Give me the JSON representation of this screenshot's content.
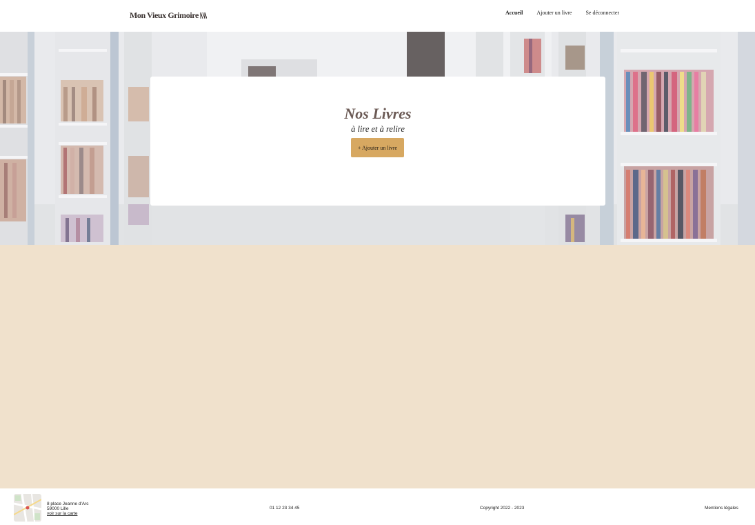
{
  "header": {
    "logo_text": "Mon Vieux Grimoire",
    "nav": [
      {
        "label": "Accueil",
        "active": true
      },
      {
        "label": "Ajouter un livre",
        "active": false
      },
      {
        "label": "Se déconnecter",
        "active": false
      }
    ]
  },
  "hero": {
    "title": "Nos Livres",
    "subtitle": "à lire et à relire",
    "button_label": "+ Ajouter un livre"
  },
  "footer": {
    "address_line1": "8 place Jeanne d'Arc",
    "address_line2": "59000 Lille",
    "map_link": "voir sur la carte",
    "phone": "01 12 23 34 45",
    "copyright": "Copyright 2022 - 2023",
    "legal": "Mentions légales"
  },
  "colors": {
    "accent_button": "#d7a861",
    "main_background": "#f0e1cc",
    "title_color": "#6b5a55"
  },
  "icons": {
    "logo_mark": "open-book-icon",
    "map": "map-thumbnail-icon"
  }
}
